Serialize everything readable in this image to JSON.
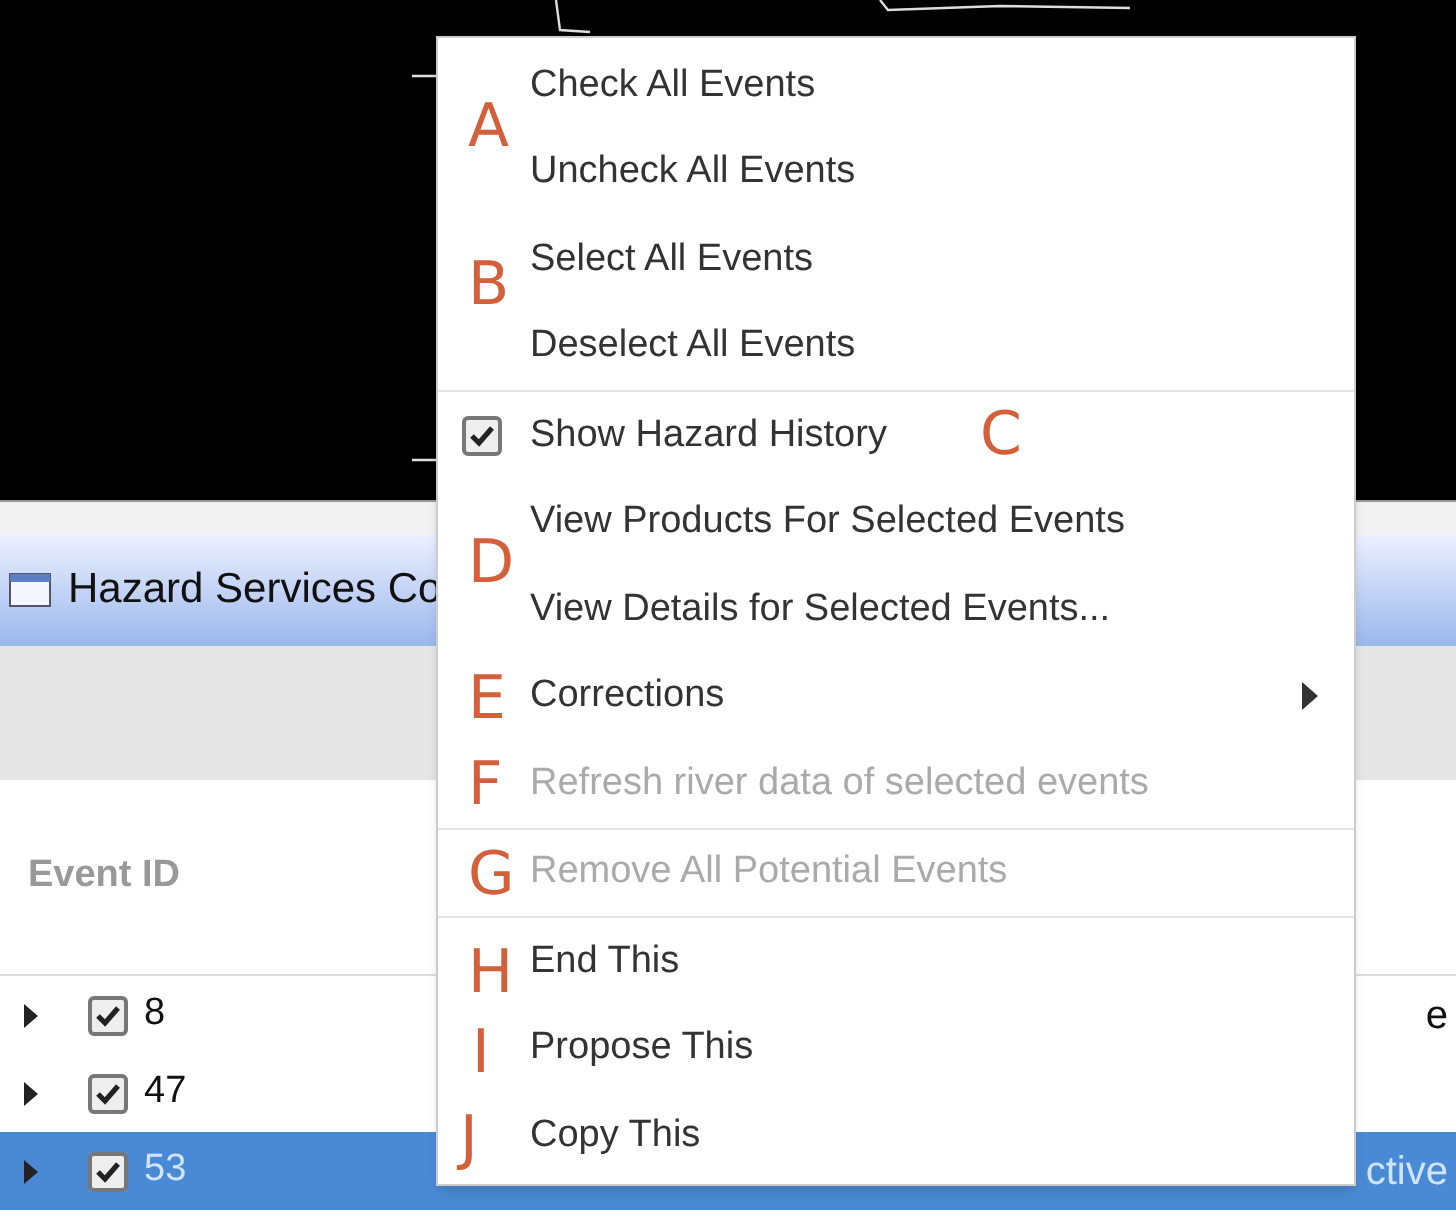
{
  "window": {
    "title": "Hazard Services Co"
  },
  "table": {
    "columns": [
      {
        "label": "Event ID"
      }
    ],
    "rows": [
      {
        "id": "8",
        "checked": true,
        "selected": false,
        "column_3": "e"
      },
      {
        "id": "47",
        "checked": true,
        "selected": false,
        "column_3": ""
      },
      {
        "id": "53",
        "checked": true,
        "selected": true,
        "column_3": "ctive"
      }
    ]
  },
  "context_menu": {
    "items": [
      {
        "kind": "item",
        "label": "Check All Events",
        "disabled": false
      },
      {
        "kind": "item",
        "label": "Uncheck All Events",
        "disabled": false
      },
      {
        "kind": "item",
        "label": "Select All Events",
        "disabled": false
      },
      {
        "kind": "item",
        "label": "Deselect All Events",
        "disabled": false
      },
      {
        "kind": "separator"
      },
      {
        "kind": "check",
        "label": "Show Hazard History",
        "disabled": false,
        "checked": true
      },
      {
        "kind": "item",
        "label": "View Products For Selected Events",
        "disabled": false
      },
      {
        "kind": "item",
        "label": "View Details for Selected Events...",
        "disabled": false
      },
      {
        "kind": "submenu",
        "label": "Corrections",
        "disabled": false
      },
      {
        "kind": "item",
        "label": "Refresh river data of selected events",
        "disabled": true
      },
      {
        "kind": "separator"
      },
      {
        "kind": "item",
        "label": "Remove All Potential Events",
        "disabled": true
      },
      {
        "kind": "separator"
      },
      {
        "kind": "item",
        "label": "End This",
        "disabled": false
      },
      {
        "kind": "item",
        "label": "Propose This",
        "disabled": false
      },
      {
        "kind": "item",
        "label": "Copy This",
        "disabled": false
      }
    ]
  },
  "annotations": [
    {
      "letter": "A"
    },
    {
      "letter": "B"
    },
    {
      "letter": "C"
    },
    {
      "letter": "D"
    },
    {
      "letter": "E"
    },
    {
      "letter": "F"
    },
    {
      "letter": "G"
    },
    {
      "letter": "H"
    },
    {
      "letter": "I"
    },
    {
      "letter": "J"
    }
  ]
}
